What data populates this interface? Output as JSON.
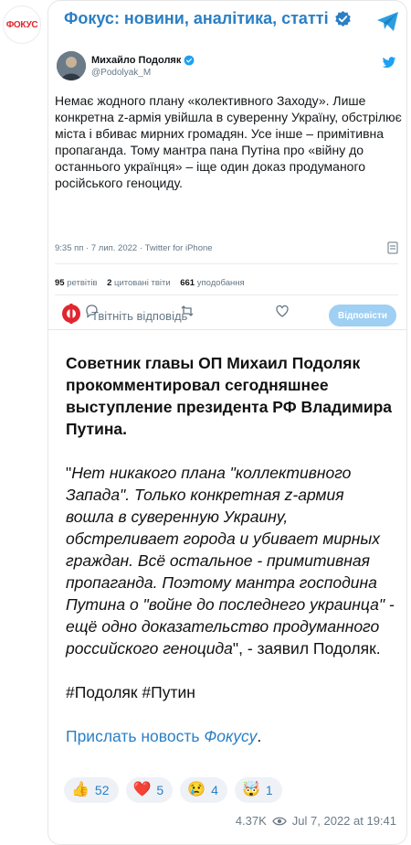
{
  "channel": {
    "avatar_text": "ФОКУС",
    "title": "Фокус: новини, аналітика, статті"
  },
  "tweet": {
    "author_name": "Михайло Подоляк",
    "handle": "@Podolyak_M",
    "text": "Немає жодного плану «колективного Заходу». Лише конкретна z-армія увійшла в суверенну Україну, обстрілює міста і вбиває мирних громадян. Усе інше – примітивна пропаганда. Тому мантра пана Путіна про «війну до останнього українця» – іще один доказ продуманого російського геноциду.",
    "meta": "9:35 пп · 7 лип. 2022 · Twitter for iPhone",
    "retweets_count": "95",
    "retweets_label": "ретвітів",
    "quotes_count": "2",
    "quotes_label": "цитовані твіти",
    "likes_count": "661",
    "likes_label": "уподобання",
    "reply_placeholder": "Твітніть відповідь",
    "reply_button": "Відповісти"
  },
  "post": {
    "lead": "Советник главы ОП Михаил Подоляк прокомментировал сегодняшнее выступление президента РФ Владимира Путина.",
    "quote_open": "\"",
    "quote_italic": "Нет никакого плана \"коллективного Запада\". Только конкретная z-армия вошла в суверенную Украину, обстреливает города и убивает мирных граждан. Всё остальное - примитивная пропаганда. Поэтому мантра господина Путина о \"войне до последнего украинца\" - ещё одно доказательство продуманного российского геноцида",
    "quote_close": "\", - заявил Подоляк.",
    "hashtags": "#Подоляк #Путин",
    "link_prefix": "Прислать новость ",
    "link_brand": "Фокусу",
    "link_suffix": "."
  },
  "reactions": [
    {
      "emoji": "👍",
      "count": "52"
    },
    {
      "emoji": "❤️",
      "count": "5"
    },
    {
      "emoji": "😢",
      "count": "4"
    },
    {
      "emoji": "🤯",
      "count": "1"
    }
  ],
  "footer": {
    "views": "4.37K",
    "datetime": "Jul 7, 2022 at 19:41"
  },
  "colors": {
    "accent": "#2a7fc5",
    "brand_red": "#e0262f",
    "reply_button": "#9fcff3"
  }
}
